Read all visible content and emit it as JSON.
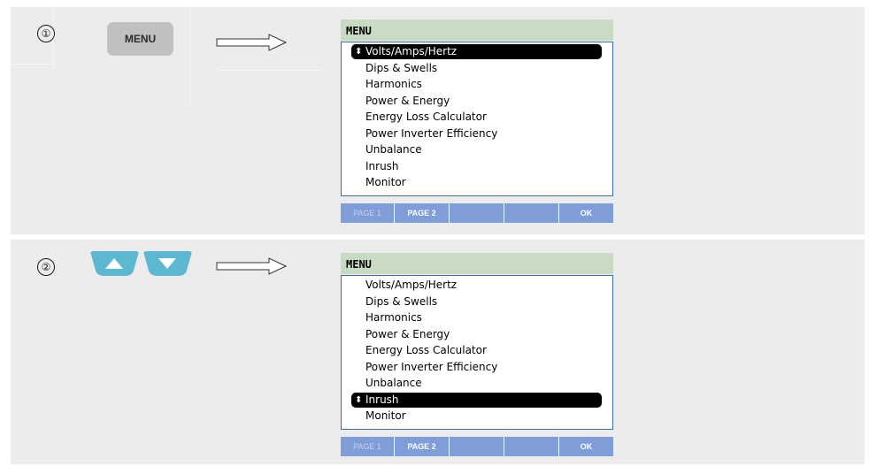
{
  "steps": [
    {
      "number": "①",
      "key": {
        "type": "menu-button",
        "label": "MENU"
      },
      "screen": {
        "title": "MENU",
        "items": [
          "Volts/Amps/Hertz",
          "Dips & Swells",
          "Harmonics",
          "Power & Energy",
          "Energy Loss Calculator",
          "Power Inverter Efficiency",
          "Unbalance",
          "Inrush",
          "Monitor"
        ],
        "selected_index": 0,
        "softkeys": [
          "PAGE 1",
          "PAGE 2",
          "",
          "",
          "OK"
        ]
      }
    },
    {
      "number": "②",
      "key": {
        "type": "arrow-keys",
        "icons": [
          "up-arrow-icon",
          "down-arrow-icon"
        ]
      },
      "screen": {
        "title": "MENU",
        "items": [
          "Volts/Amps/Hertz",
          "Dips & Swells",
          "Harmonics",
          "Power & Energy",
          "Energy Loss Calculator",
          "Power Inverter Efficiency",
          "Unbalance",
          "Inrush",
          "Monitor"
        ],
        "selected_index": 7,
        "softkeys": [
          "PAGE 1",
          "PAGE 2",
          "",
          "",
          "OK"
        ]
      }
    }
  ],
  "colors": {
    "panel_bg": "#ececec",
    "title_bar": "#c9dbc2",
    "softkey_bar": "#7f9dd9",
    "menu_border": "#3a6ea8",
    "nav_key": "#5bb8d0",
    "menu_key": "#c0c0c0"
  },
  "icons": {
    "selection_marker": "up-down-arrow-icon",
    "transition": "right-arrow-icon"
  }
}
